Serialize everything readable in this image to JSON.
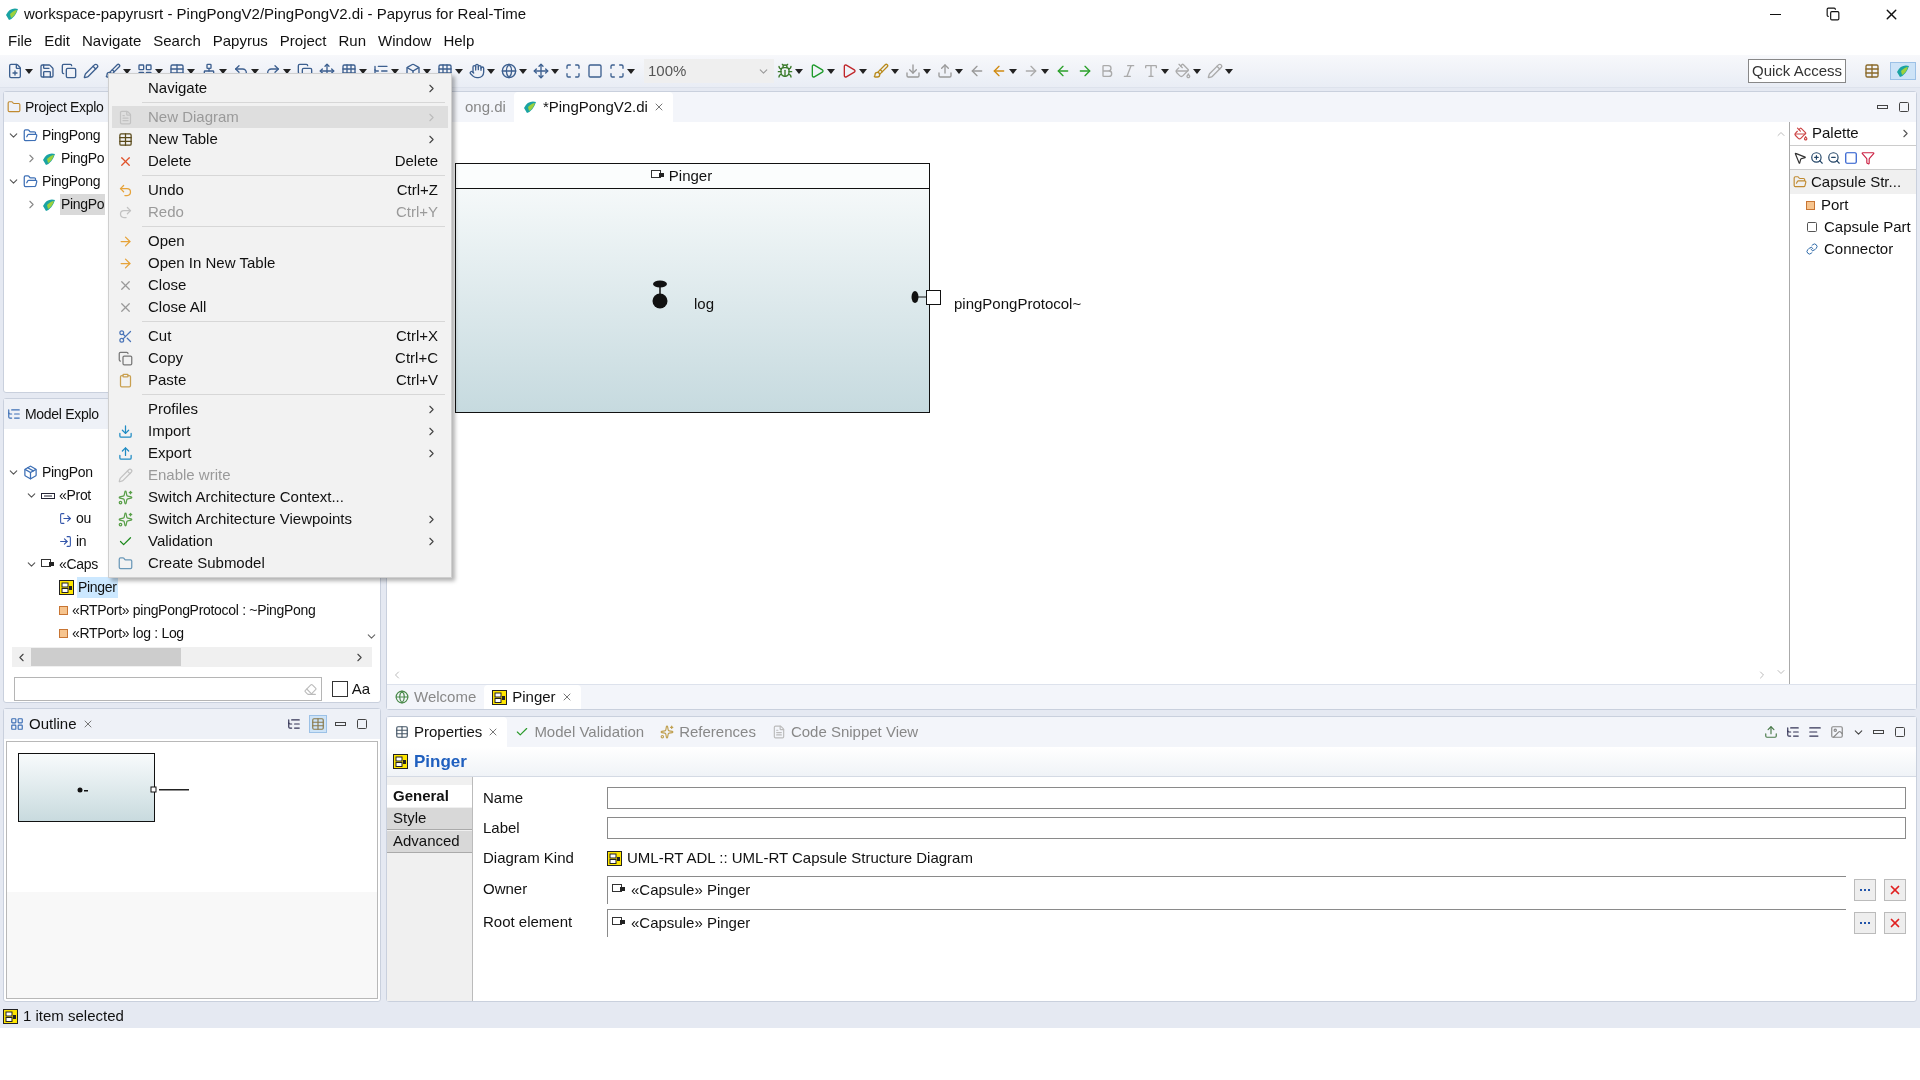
{
  "window": {
    "title": "workspace-papyrusrt - PingPongV2/PingPongV2.di - Papyrus for Real-Time"
  },
  "menu_bar": [
    "File",
    "Edit",
    "Navigate",
    "Search",
    "Papyrus",
    "Project",
    "Run",
    "Window",
    "Help"
  ],
  "toolbar": {
    "zoom": "100%",
    "quick_access": "Quick Access"
  },
  "project_explorer": {
    "title": "Project Explo",
    "items": [
      {
        "label": "PingPong",
        "kind": "folder",
        "expanded": true,
        "selected": false,
        "children": [
          {
            "label": "PingPo",
            "kind": "model",
            "expanded": false,
            "selected": false
          }
        ]
      },
      {
        "label": "PingPong",
        "kind": "folder",
        "expanded": true,
        "selected": false,
        "children": [
          {
            "label": "PingPo",
            "kind": "model",
            "expanded": false,
            "selected": true
          }
        ]
      }
    ]
  },
  "model_explorer": {
    "title": "Model Explo",
    "items": [
      {
        "label": "PingPon",
        "kind": "package",
        "expanded": true,
        "selected": false,
        "children": [
          {
            "label": "«Prot",
            "kind": "protocol",
            "expanded": true,
            "selected": false,
            "children": [
              {
                "label": "ou",
                "kind": "out",
                "selected": false
              },
              {
                "label": "in",
                "kind": "in",
                "selected": false
              }
            ]
          },
          {
            "label": "«Caps",
            "kind": "capsule",
            "expanded": true,
            "selected": false,
            "children": [
              {
                "label": "Pinger",
                "kind": "diagram",
                "selected": true
              },
              {
                "label": "«RTPort» pingPongProtocol : ~PingPong",
                "kind": "port",
                "selected": false
              },
              {
                "label": "«RTPort» log : Log",
                "kind": "port",
                "selected": false
              }
            ]
          }
        ]
      }
    ],
    "filter_checkbox": {
      "label": "Aa",
      "checked": false
    }
  },
  "outline": {
    "title": "Outline"
  },
  "editor": {
    "tabs": [
      {
        "label": "ong.di",
        "selected": false,
        "closable": false
      },
      {
        "label": "*PingPongV2.di",
        "selected": true,
        "closable": true
      }
    ],
    "diagram": {
      "capsule": "Pinger",
      "ports": [
        {
          "label": "log",
          "kind": "internal"
        },
        {
          "label": "pingPongProtocol~",
          "kind": "border"
        }
      ]
    },
    "bottom_tabs": [
      {
        "label": "Welcome",
        "kind": "welcome",
        "selected": false,
        "closable": false
      },
      {
        "label": "Pinger",
        "kind": "diagram",
        "selected": true,
        "closable": true
      }
    ]
  },
  "palette": {
    "title": "Palette",
    "drawer": "Capsule Str...",
    "tools": [
      {
        "label": "Port",
        "kind": "port"
      },
      {
        "label": "Capsule Part",
        "kind": "part"
      },
      {
        "label": "Connector",
        "kind": "connector"
      }
    ]
  },
  "context_menu": {
    "items": [
      {
        "kind": "item",
        "label": "Navigate",
        "submenu": true,
        "disabled": false,
        "selected": false
      },
      {
        "kind": "separator"
      },
      {
        "kind": "item",
        "label": "New Diagram",
        "submenu": true,
        "disabled": true,
        "selected": true
      },
      {
        "kind": "item",
        "label": "New Table",
        "submenu": true,
        "disabled": false,
        "selected": false
      },
      {
        "kind": "item",
        "label": "Delete",
        "shortcut": "Delete",
        "submenu": false,
        "disabled": false,
        "selected": false
      },
      {
        "kind": "separator"
      },
      {
        "kind": "item",
        "label": "Undo",
        "shortcut": "Ctrl+Z",
        "submenu": false,
        "disabled": false,
        "selected": false
      },
      {
        "kind": "item",
        "label": "Redo",
        "shortcut": "Ctrl+Y",
        "submenu": false,
        "disabled": true,
        "selected": false
      },
      {
        "kind": "separator"
      },
      {
        "kind": "item",
        "label": "Open",
        "submenu": false,
        "disabled": false,
        "selected": false
      },
      {
        "kind": "item",
        "label": "Open In New Table",
        "submenu": false,
        "disabled": false,
        "selected": false
      },
      {
        "kind": "item",
        "label": "Close",
        "submenu": false,
        "disabled": false,
        "selected": false
      },
      {
        "kind": "item",
        "label": "Close All",
        "submenu": false,
        "disabled": false,
        "selected": false
      },
      {
        "kind": "separator"
      },
      {
        "kind": "item",
        "label": "Cut",
        "shortcut": "Ctrl+X",
        "submenu": false,
        "disabled": false,
        "selected": false
      },
      {
        "kind": "item",
        "label": "Copy",
        "shortcut": "Ctrl+C",
        "submenu": false,
        "disabled": false,
        "selected": false
      },
      {
        "kind": "item",
        "label": "Paste",
        "shortcut": "Ctrl+V",
        "submenu": false,
        "disabled": false,
        "selected": false
      },
      {
        "kind": "separator"
      },
      {
        "kind": "item",
        "label": "Profiles",
        "submenu": true,
        "disabled": false,
        "selected": false
      },
      {
        "kind": "item",
        "label": "Import",
        "submenu": true,
        "disabled": false,
        "selected": false
      },
      {
        "kind": "item",
        "label": "Export",
        "submenu": true,
        "disabled": false,
        "selected": false
      },
      {
        "kind": "item",
        "label": "Enable write",
        "submenu": false,
        "disabled": true,
        "selected": false
      },
      {
        "kind": "item",
        "label": "Switch Architecture Context...",
        "submenu": false,
        "disabled": false,
        "selected": false
      },
      {
        "kind": "item",
        "label": "Switch Architecture Viewpoints",
        "submenu": true,
        "disabled": false,
        "selected": false
      },
      {
        "kind": "item",
        "label": "Validation",
        "submenu": true,
        "disabled": false,
        "selected": false
      },
      {
        "kind": "item",
        "label": "Create Submodel",
        "submenu": false,
        "disabled": false,
        "selected": false
      }
    ]
  },
  "properties": {
    "tabs": [
      {
        "label": "Properties",
        "selected": true,
        "closable": true
      },
      {
        "label": "Model Validation",
        "selected": false,
        "closable": false
      },
      {
        "label": "References",
        "selected": false,
        "closable": false
      },
      {
        "label": "Code Snippet View",
        "selected": false,
        "closable": false
      }
    ],
    "title": "Pinger",
    "sections": [
      {
        "label": "General",
        "selected": true
      },
      {
        "label": "Style",
        "selected": false
      },
      {
        "label": "Advanced",
        "selected": false
      }
    ],
    "fields": [
      {
        "label": "Name",
        "kind": "input"
      },
      {
        "label": "Label",
        "kind": "input"
      },
      {
        "label": "Diagram Kind",
        "kind": "text",
        "value": "UML-RT ADL :: UML-RT Capsule Structure Diagram"
      },
      {
        "label": "Owner",
        "kind": "reference",
        "value": "«Capsule» Pinger"
      },
      {
        "label": "Root element",
        "kind": "reference",
        "value": "«Capsule» Pinger"
      }
    ]
  },
  "status_bar": {
    "text": "1 item selected"
  }
}
